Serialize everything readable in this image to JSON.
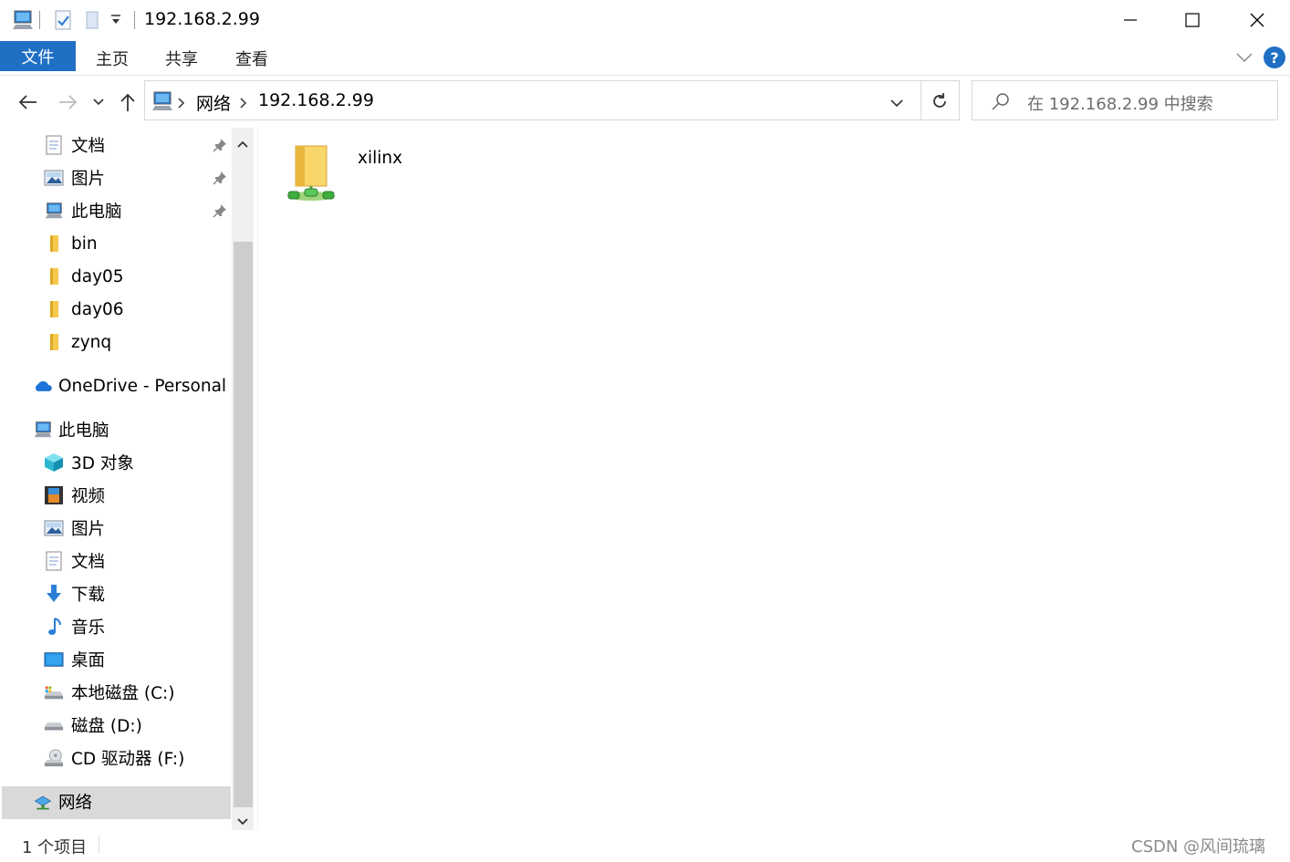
{
  "window": {
    "title": "192.168.2.99",
    "minimize": "minimize",
    "maximize": "maximize",
    "close": "close"
  },
  "ribbon": {
    "tabs": [
      "文件",
      "主页",
      "共享",
      "查看"
    ],
    "help": "?"
  },
  "address": {
    "segments": [
      "网络",
      "192.168.2.99"
    ]
  },
  "search": {
    "placeholder": "在 192.168.2.99 中搜索"
  },
  "sidebar": {
    "quick_access": [
      {
        "label": "文档",
        "icon": "documents-icon",
        "pinned": true
      },
      {
        "label": "图片",
        "icon": "pictures-icon",
        "pinned": true
      },
      {
        "label": "此电脑",
        "icon": "this-pc-icon",
        "pinned": true
      },
      {
        "label": "bin",
        "icon": "folder-icon",
        "pinned": false
      },
      {
        "label": "day05",
        "icon": "folder-icon",
        "pinned": false
      },
      {
        "label": "day06",
        "icon": "folder-icon",
        "pinned": false
      },
      {
        "label": "zynq",
        "icon": "folder-icon",
        "pinned": false
      }
    ],
    "onedrive": "OneDrive - Personal",
    "this_pc": "此电脑",
    "this_pc_items": [
      {
        "label": "3D 对象",
        "icon": "3d-objects-icon"
      },
      {
        "label": "视频",
        "icon": "videos-icon"
      },
      {
        "label": "图片",
        "icon": "pictures-icon"
      },
      {
        "label": "文档",
        "icon": "documents-icon"
      },
      {
        "label": "下载",
        "icon": "downloads-icon"
      },
      {
        "label": "音乐",
        "icon": "music-icon"
      },
      {
        "label": "桌面",
        "icon": "desktop-icon"
      },
      {
        "label": "本地磁盘 (C:)",
        "icon": "local-disk-icon"
      },
      {
        "label": "磁盘 (D:)",
        "icon": "disk-icon"
      },
      {
        "label": "CD 驱动器 (F:)",
        "icon": "cd-drive-icon"
      }
    ],
    "network": "网络"
  },
  "content": {
    "items": [
      {
        "label": "xilinx",
        "icon": "network-share-folder-icon"
      }
    ]
  },
  "status": {
    "count": "1 个项目"
  },
  "watermark": "CSDN @风间琉璃"
}
